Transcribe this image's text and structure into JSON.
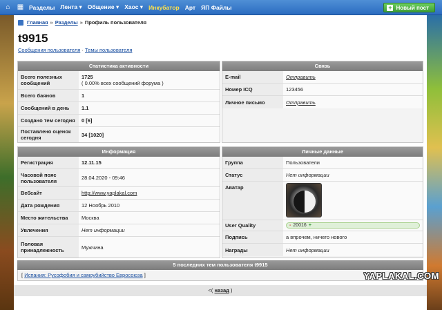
{
  "nav": {
    "items": [
      {
        "label": "Разделы",
        "yellow": false
      },
      {
        "label": "Лента ▾",
        "yellow": false
      },
      {
        "label": "Общение ▾",
        "yellow": false
      },
      {
        "label": "Хаос ▾",
        "yellow": false
      },
      {
        "label": "Инкубатор",
        "yellow": true
      },
      {
        "label": "Арт",
        "yellow": false
      },
      {
        "label": "ЯП Файлы",
        "yellow": false
      }
    ],
    "new_post": "Новый пост"
  },
  "breadcrumb": {
    "home": "Главная",
    "sep1": "»",
    "sections": "Разделы",
    "sep2": "»",
    "current": "Профиль пользователя"
  },
  "profile": {
    "username": "t9915",
    "messages_link": "Сообщения пользователя",
    "sep": "·",
    "topics_link": "Темы пользователя"
  },
  "activity": {
    "title": "Статистика активности",
    "useful_label": "Всего полезных сообщений",
    "useful_value": "1725",
    "useful_sub": "( 0.00% всех сообщений форума )",
    "bans_label": "Всего баянов",
    "bans_value": "1",
    "per_day_label": "Сообщений в день",
    "per_day_value": "1.1",
    "topics_today_label": "Создано тем сегодня",
    "topics_today_value": "0 [6]",
    "ratings_label": "Поставлено оценок сегодня",
    "ratings_value": "34 [1020]"
  },
  "contact": {
    "title": "Связь",
    "email_label": "E-mail",
    "email_value": "Отправить",
    "icq_label": "Номер ICQ",
    "icq_value": "123456",
    "pm_label": "Личное письмо",
    "pm_value": "Отправить"
  },
  "info": {
    "title": "Информация",
    "reg_label": "Регистрация",
    "reg_value": "12.11.15",
    "tz_label": "Часовой пояс пользователя",
    "tz_value": "28.04.2020 - 09:46",
    "web_label": "Вебсайт",
    "web_value": "http://www.yaplakal.com",
    "birth_label": "Дата рождения",
    "birth_value": "12 Ноябрь 2010",
    "place_label": "Место жительства",
    "place_value": "Москва",
    "hobby_label": "Увлечения",
    "hobby_value": "Нет информации",
    "gender_label": "Половая принадлежность",
    "gender_value": "Мужчина"
  },
  "personal": {
    "title": "Личные данные",
    "group_label": "Группа",
    "group_value": "Пользователи",
    "status_label": "Статус",
    "status_value": "Нет информации",
    "avatar_label": "Аватар",
    "quality_label": "User Quality",
    "quality_minus": "-",
    "quality_value": "20016",
    "quality_plus": "+",
    "signature_label": "Подпись",
    "signature_value": "а впрочем, ничего нового",
    "awards_label": "Награды",
    "awards_value": "Нет информации"
  },
  "recent": {
    "title": "5 последних тем пользователя t9915",
    "open": "[",
    "topic": "Испания: Русофобия и самоубийство Евросоюза",
    "close": "]"
  },
  "back": {
    "prefix": "<(",
    "link": "назад",
    "suffix": ")"
  },
  "watermark": "YAPLAKAL.COM"
}
